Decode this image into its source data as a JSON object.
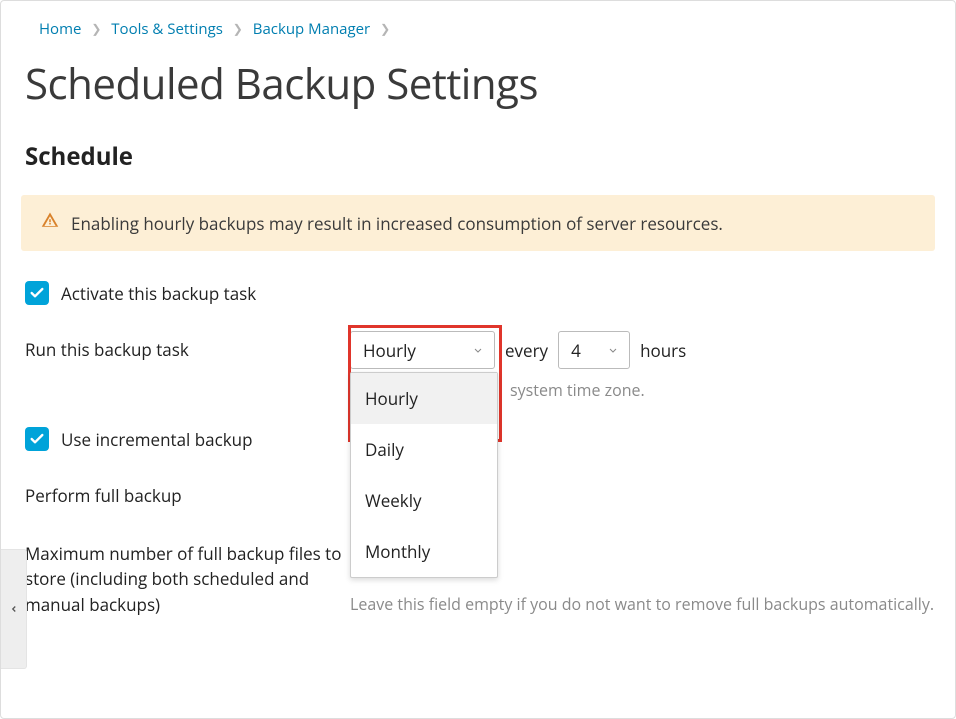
{
  "breadcrumb": {
    "items": [
      "Home",
      "Tools & Settings",
      "Backup Manager"
    ]
  },
  "page_title": "Scheduled Backup Settings",
  "section_title": "Schedule",
  "alert": {
    "text": "Enabling hourly backups may result in increased consumption of server resources."
  },
  "activate": {
    "label": "Activate this backup task",
    "checked": true
  },
  "run_task": {
    "label": "Run this backup task",
    "frequency_value": "Hourly",
    "every_text": "every",
    "hours_value": "4",
    "hours_suffix": "hours",
    "timezone_hint": "system time zone.",
    "options": [
      "Hourly",
      "Daily",
      "Weekly",
      "Monthly"
    ]
  },
  "incremental": {
    "label": "Use incremental backup",
    "checked": true
  },
  "full_backup": {
    "label": "Perform full backup"
  },
  "max_files": {
    "label": "Maximum number of full backup files to store (including both scheduled and manual backups)",
    "hint": "Leave this field empty if you do not want to remove full backups automatically."
  }
}
